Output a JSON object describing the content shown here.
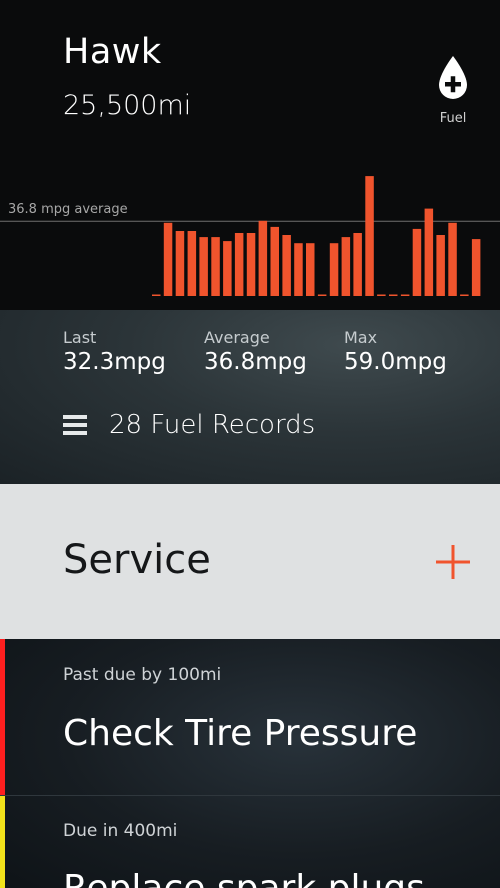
{
  "vehicle": {
    "name": "Hawk",
    "mileage": "25,500mi"
  },
  "fuel_button": {
    "label": "Fuel",
    "icon": "fuel-drop-plus-icon"
  },
  "colors": {
    "accent": "#f0542d",
    "overdue": "#ff1f1f",
    "upcoming": "#f2e21b"
  },
  "chart_data": {
    "type": "bar",
    "average_label": "36.8 mpg average",
    "average_value": 36.8,
    "values": [
      0,
      36,
      32,
      32,
      29,
      29,
      27,
      31,
      31,
      37,
      34,
      30,
      26,
      26,
      0,
      26,
      29,
      31,
      59,
      0,
      0,
      0,
      33,
      43,
      30,
      36,
      0,
      28
    ],
    "ylim": [
      0,
      62
    ]
  },
  "fuel_stats": {
    "last": {
      "label": "Last",
      "value": "32.3mpg"
    },
    "average": {
      "label": "Average",
      "value": "36.8mpg"
    },
    "max": {
      "label": "Max",
      "value": "59.0mpg"
    },
    "records_label": "28 Fuel Records"
  },
  "service": {
    "title": "Service"
  },
  "service_items": [
    {
      "due": "Past due by 100mi",
      "title": "Check Tire Pressure"
    },
    {
      "due": "Due in 400mi",
      "title": "Replace spark plugs"
    }
  ]
}
